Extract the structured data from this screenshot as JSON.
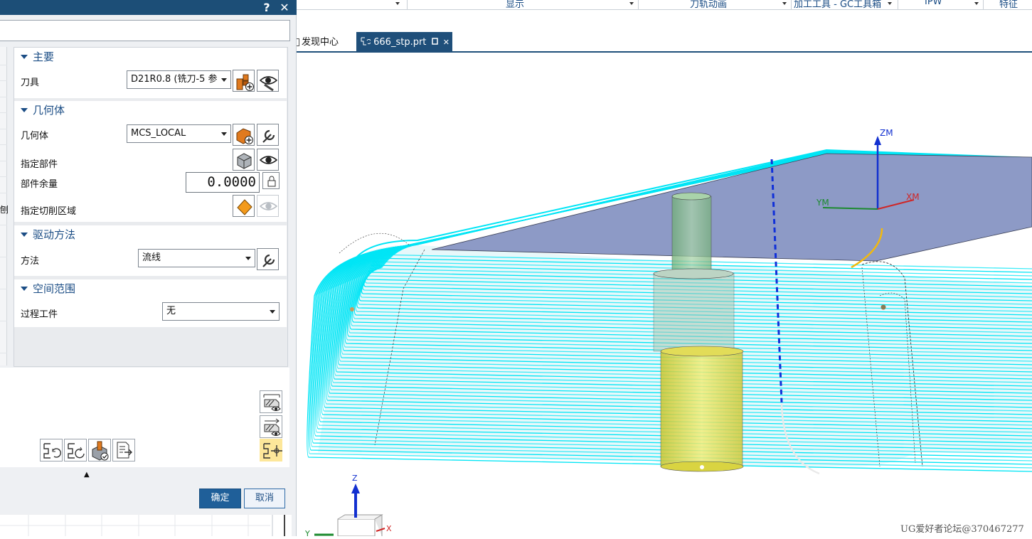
{
  "dialog": {
    "help_label": "?",
    "close_label": "✕",
    "groups": {
      "main": {
        "title": "主要",
        "tool_label": "刀具",
        "tool_value": "D21R0.8 (铣刀-5 参"
      },
      "geometry": {
        "title": "几何体",
        "geometry_label": "几何体",
        "geometry_value": "MCS_LOCAL",
        "part_label": "指定部件",
        "stock_label": "部件余量",
        "stock_value": "0.0000",
        "cut_area_label": "指定切削区域"
      },
      "drive": {
        "title": "驱动方法",
        "method_label": "方法",
        "method_value": "流线"
      },
      "space": {
        "title": "空间范围",
        "ipw_label": "过程工件",
        "ipw_value": "无"
      }
    },
    "side_char": "刨",
    "ok_label": "确定",
    "cancel_label": "取消",
    "collapse_glyph": "▲"
  },
  "toolbar": {
    "items": [
      "显示",
      "刀轨动画",
      "加工工具 - GC工具箱",
      "IPW",
      "特征"
    ]
  },
  "tabs": [
    {
      "label": "发现中心",
      "active": false
    },
    {
      "label": "666_stp.prt",
      "active": true,
      "close": "✕"
    }
  ],
  "viewport": {
    "axis_labels": {
      "zm": "ZM",
      "ym": "YM",
      "xm": "XM",
      "z": "Z",
      "y": "Y",
      "x": "X"
    },
    "colors": {
      "toolpath": "#00e5f5",
      "tool_holder": "#7fbf7f",
      "tool_body": "#e8e24a",
      "top_face": "#8e9cc7"
    }
  },
  "watermark": "UG爱好者论坛@370467277"
}
